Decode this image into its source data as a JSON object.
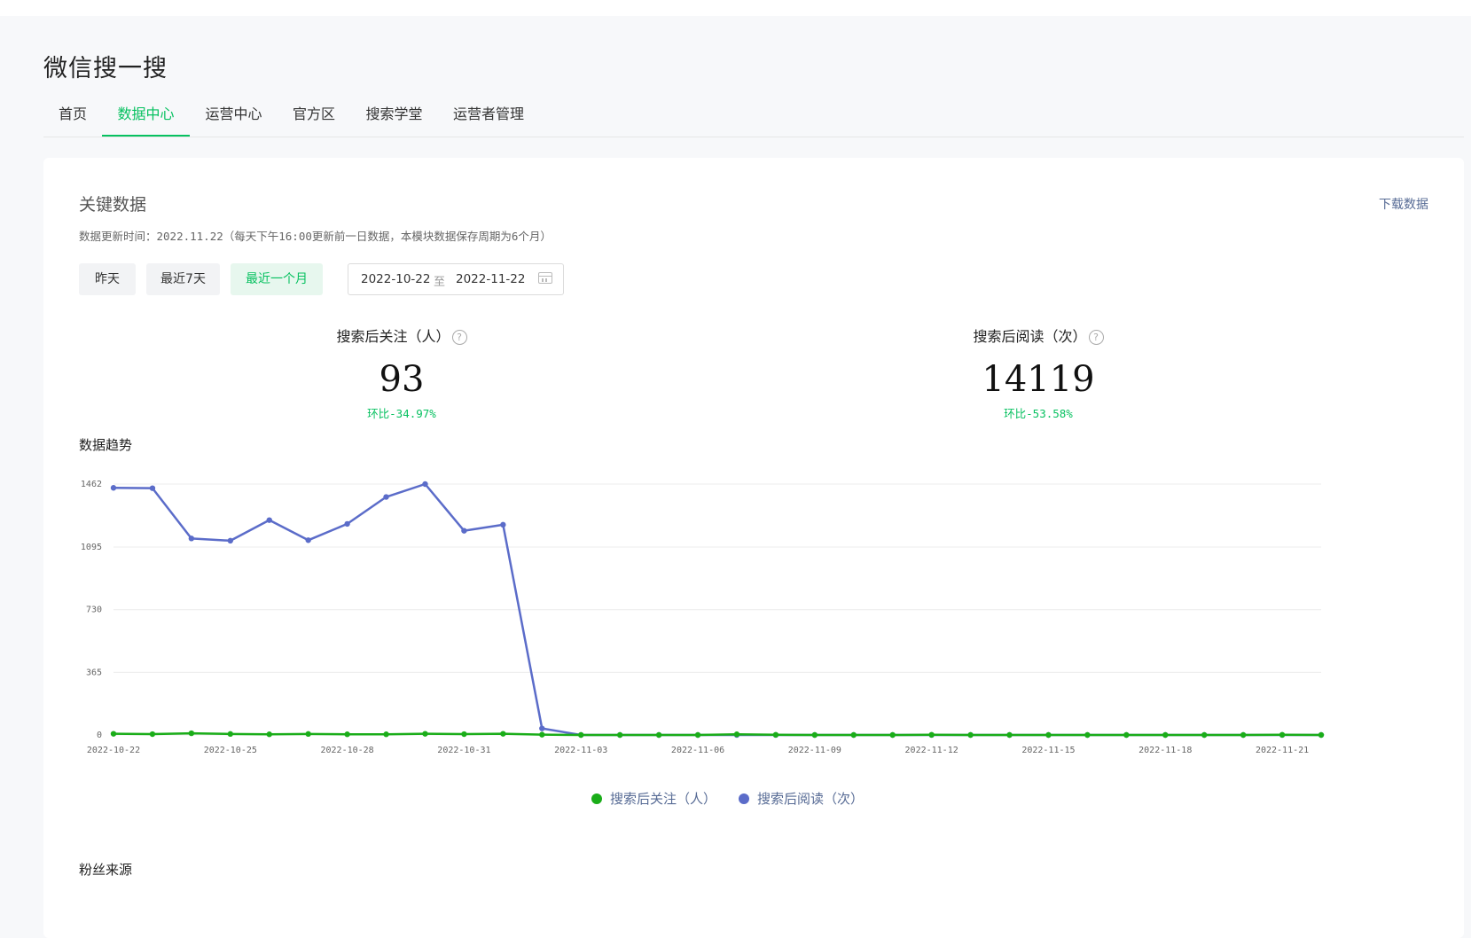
{
  "app": {
    "title": "微信搜一搜"
  },
  "nav": {
    "tabs": [
      "首页",
      "数据中心",
      "运营中心",
      "官方区",
      "搜索学堂",
      "运营者管理"
    ],
    "active": "数据中心"
  },
  "key_data": {
    "title": "关键数据",
    "download": "下载数据",
    "update_info": "数据更新时间：2022.11.22（每天下午16:00更新前一日数据，本模块数据保存周期为6个月）",
    "filters": [
      "昨天",
      "最近7天",
      "最近一个月"
    ],
    "active_filter": "最近一个月",
    "date_start": "2022-10-22",
    "date_sep": "至",
    "date_end": "2022-11-22"
  },
  "metrics": [
    {
      "label": "搜索后关注（人）",
      "value": "93",
      "change": "环比-34.97%"
    },
    {
      "label": "搜索后阅读（次）",
      "value": "14119",
      "change": "环比-53.58%"
    }
  ],
  "trend": {
    "title": "数据趋势"
  },
  "fans": {
    "title": "粉丝来源"
  },
  "colors": {
    "accent": "#07c160",
    "follow_series": "#1aad19",
    "read_series": "#5b6cc9",
    "link": "#576b95"
  },
  "chart_data": {
    "type": "line",
    "x": [
      "2022-10-22",
      "2022-10-23",
      "2022-10-24",
      "2022-10-25",
      "2022-10-26",
      "2022-10-27",
      "2022-10-28",
      "2022-10-29",
      "2022-10-30",
      "2022-10-31",
      "2022-11-01",
      "2022-11-02",
      "2022-11-03",
      "2022-11-04",
      "2022-11-05",
      "2022-11-06",
      "2022-11-07",
      "2022-11-08",
      "2022-11-09",
      "2022-11-10",
      "2022-11-11",
      "2022-11-12",
      "2022-11-13",
      "2022-11-14",
      "2022-11-15",
      "2022-11-16",
      "2022-11-17",
      "2022-11-18",
      "2022-11-19",
      "2022-11-20",
      "2022-11-21",
      "2022-11-22"
    ],
    "xticks": [
      "2022-10-22",
      "2022-10-25",
      "2022-10-28",
      "2022-10-31",
      "2022-11-03",
      "2022-11-06",
      "2022-11-09",
      "2022-11-12",
      "2022-11-15",
      "2022-11-18",
      "2022-11-21"
    ],
    "yticks": [
      0,
      365,
      730,
      1095,
      1462
    ],
    "ylim": [
      0,
      1462
    ],
    "grid": true,
    "legend_position": "bottom-center",
    "series": [
      {
        "name": "搜索后关注（人）",
        "color": "#1aad19",
        "values": [
          7,
          5,
          10,
          6,
          4,
          6,
          4,
          4,
          7,
          5,
          7,
          2,
          0,
          0,
          0,
          0,
          4,
          1,
          0,
          0,
          0,
          1,
          0,
          0,
          0,
          0,
          0,
          0,
          0,
          0,
          1,
          0
        ]
      },
      {
        "name": "搜索后阅读（次）",
        "color": "#5b6cc9",
        "values": [
          1440,
          1438,
          1145,
          1132,
          1252,
          1135,
          1230,
          1387,
          1462,
          1190,
          1225,
          38,
          0,
          0,
          0,
          0,
          0,
          0,
          0,
          0,
          0,
          0,
          0,
          0,
          0,
          0,
          0,
          0,
          0,
          0,
          0,
          0
        ]
      }
    ]
  }
}
